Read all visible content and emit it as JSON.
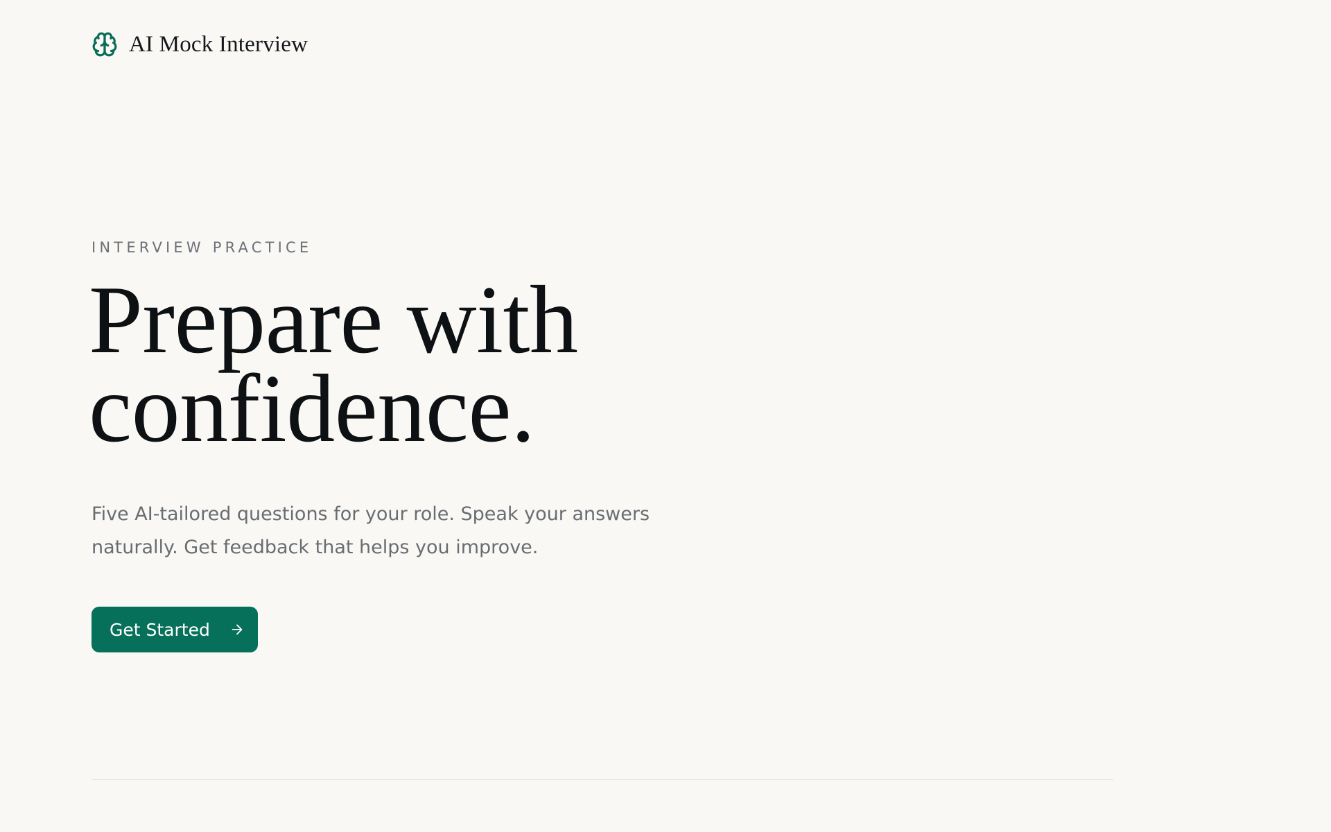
{
  "header": {
    "icon": "brain-icon",
    "brand": "AI Mock Interview"
  },
  "hero": {
    "eyebrow": "INTERVIEW PRACTICE",
    "headline_line1": "Prepare with",
    "headline_line2": "confidence.",
    "lede_line1": "Five AI-tailored questions for your role. Speak your answers",
    "lede_line2": "naturally. Get feedback that helps you improve.",
    "cta_label": "Get Started",
    "cta_icon": "arrow-right-icon"
  },
  "colors": {
    "background": "#f9f8f5",
    "accent": "#07705a",
    "heading": "#0e1113",
    "body_text": "#686d72",
    "divider": "#e2e1dc"
  }
}
